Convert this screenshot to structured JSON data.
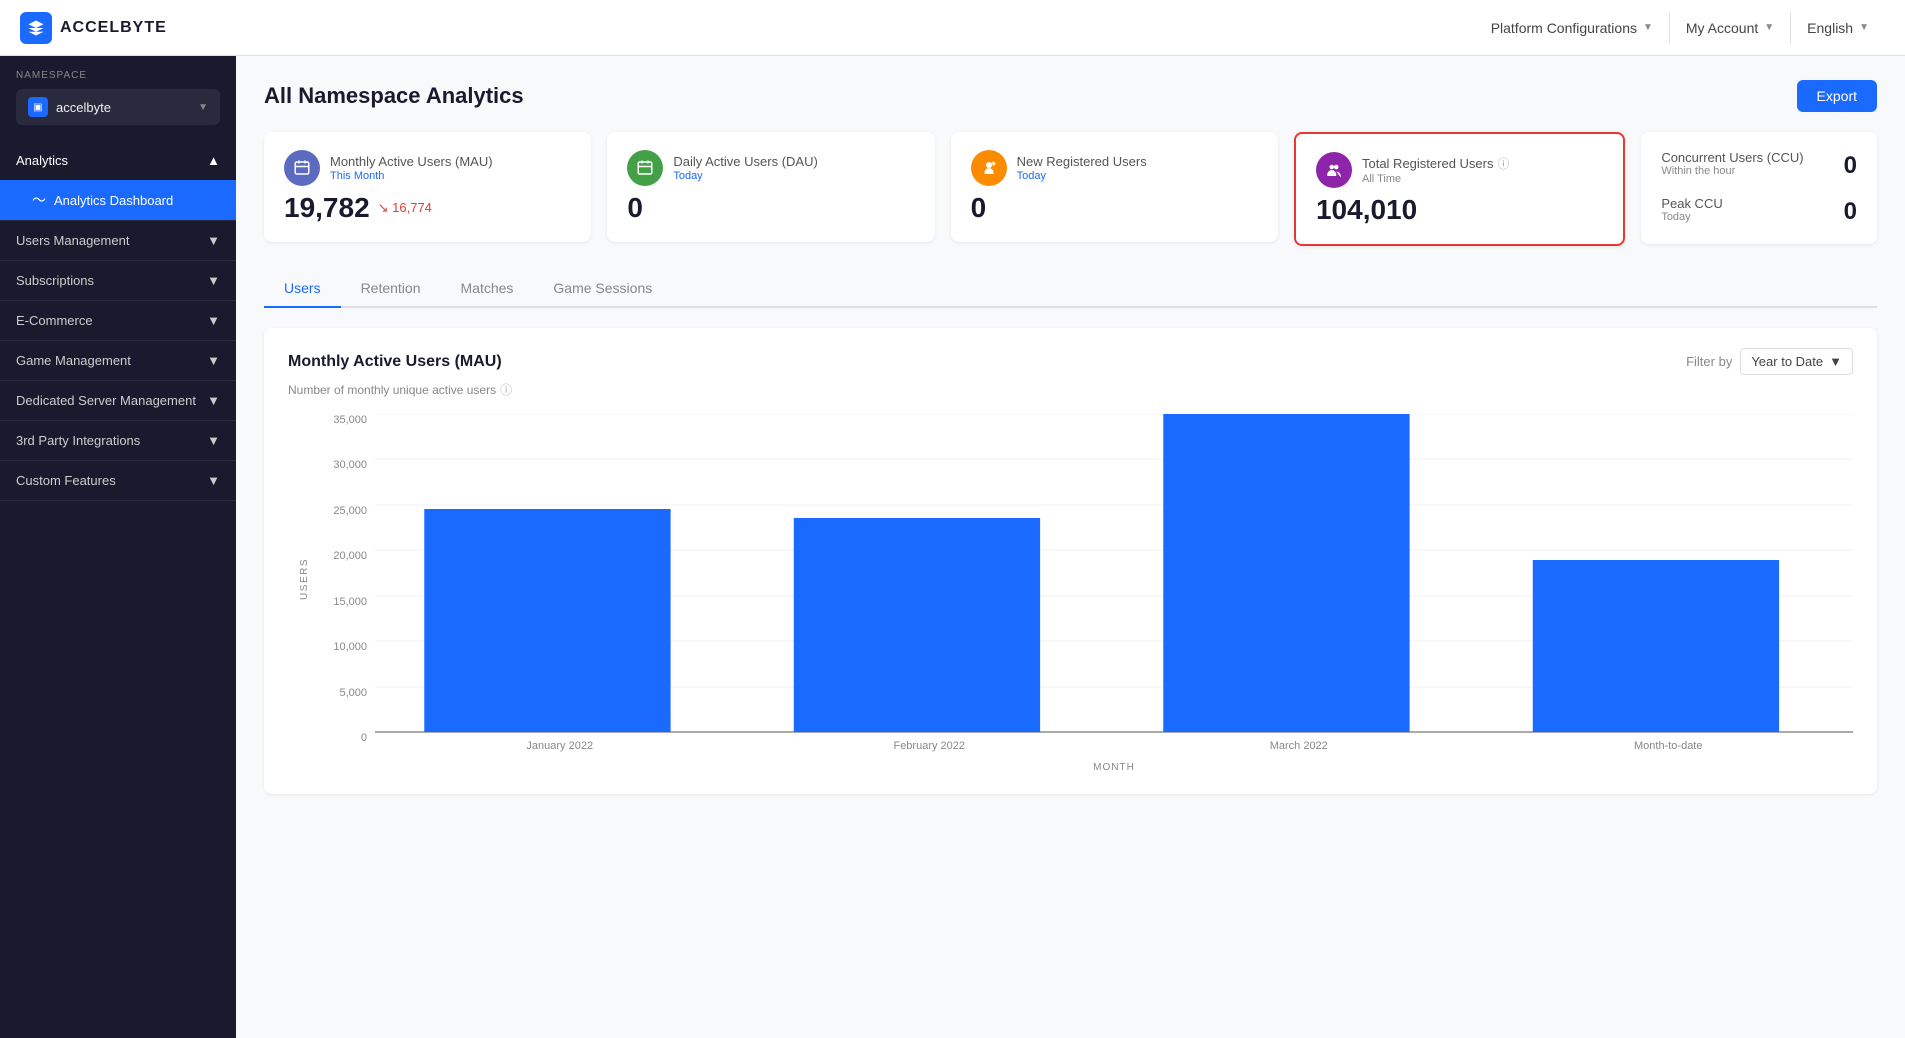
{
  "app": {
    "logo_text": "ACCELBYTE",
    "logo_abbr": "A"
  },
  "topnav": {
    "platform_config_label": "Platform Configurations",
    "my_account_label": "My Account",
    "language_label": "English"
  },
  "sidebar": {
    "namespace_label": "NAMESPACE",
    "namespace_name": "accelbyte",
    "sections": [
      {
        "key": "analytics",
        "label": "Analytics",
        "expanded": true,
        "items": [
          {
            "key": "analytics-dashboard",
            "label": "Analytics Dashboard",
            "active": true
          }
        ]
      },
      {
        "key": "users-management",
        "label": "Users Management",
        "expanded": false,
        "items": []
      },
      {
        "key": "subscriptions",
        "label": "Subscriptions",
        "expanded": false,
        "items": []
      },
      {
        "key": "ecommerce",
        "label": "E-Commerce",
        "expanded": false,
        "items": []
      },
      {
        "key": "game-management",
        "label": "Game Management",
        "expanded": false,
        "items": []
      },
      {
        "key": "dedicated-server",
        "label": "Dedicated Server Management",
        "expanded": false,
        "items": []
      },
      {
        "key": "third-party",
        "label": "3rd Party Integrations",
        "expanded": false,
        "items": []
      },
      {
        "key": "custom-features",
        "label": "Custom Features",
        "expanded": false,
        "items": []
      }
    ]
  },
  "page": {
    "title": "All Namespace Analytics",
    "export_label": "Export"
  },
  "metrics": [
    {
      "key": "mau",
      "icon_color": "blue",
      "icon": "📅",
      "label": "Monthly Active Users (MAU)",
      "sublabel": "This Month",
      "value": "19,782",
      "trend": "↘ 16,774",
      "highlighted": false
    },
    {
      "key": "dau",
      "icon_color": "green",
      "icon": "📅",
      "label": "Daily Active Users (DAU)",
      "sublabel": "Today",
      "value": "0",
      "trend": "",
      "highlighted": false
    },
    {
      "key": "nru",
      "icon_color": "orange",
      "icon": "👤",
      "label": "New Registered Users",
      "sublabel": "Today",
      "value": "0",
      "trend": "",
      "highlighted": false
    },
    {
      "key": "tru",
      "icon_color": "purple",
      "icon": "👥",
      "label": "Total Registered Users",
      "sublabel": "All Time",
      "value": "104,010",
      "trend": "",
      "highlighted": true
    }
  ],
  "ccu": {
    "concurrent_label": "Concurrent Users (CCU)",
    "concurrent_sublabel": "Within the hour",
    "concurrent_value": "0",
    "peak_label": "Peak CCU",
    "peak_sublabel": "Today",
    "peak_value": "0"
  },
  "tabs": [
    {
      "key": "users",
      "label": "Users",
      "active": true
    },
    {
      "key": "retention",
      "label": "Retention",
      "active": false
    },
    {
      "key": "matches",
      "label": "Matches",
      "active": false
    },
    {
      "key": "game-sessions",
      "label": "Game Sessions",
      "active": false
    }
  ],
  "chart": {
    "title": "Monthly Active Users (MAU)",
    "subtitle": "Number of monthly unique active users",
    "filter_label": "Filter by",
    "filter_value": "Year to Date",
    "y_axis_title": "USERS",
    "x_axis_title": "MONTH",
    "y_labels": [
      "35,000",
      "30,000",
      "25,000",
      "20,000",
      "15,000",
      "10,000",
      "5,000",
      "0"
    ],
    "bars": [
      {
        "label": "January 2022",
        "value": 26000,
        "max": 37000
      },
      {
        "label": "February 2022",
        "value": 25000,
        "max": 37000
      },
      {
        "label": "March 2022",
        "value": 37000,
        "max": 37000
      },
      {
        "label": "Month-to-date",
        "value": 20000,
        "max": 37000
      }
    ]
  }
}
